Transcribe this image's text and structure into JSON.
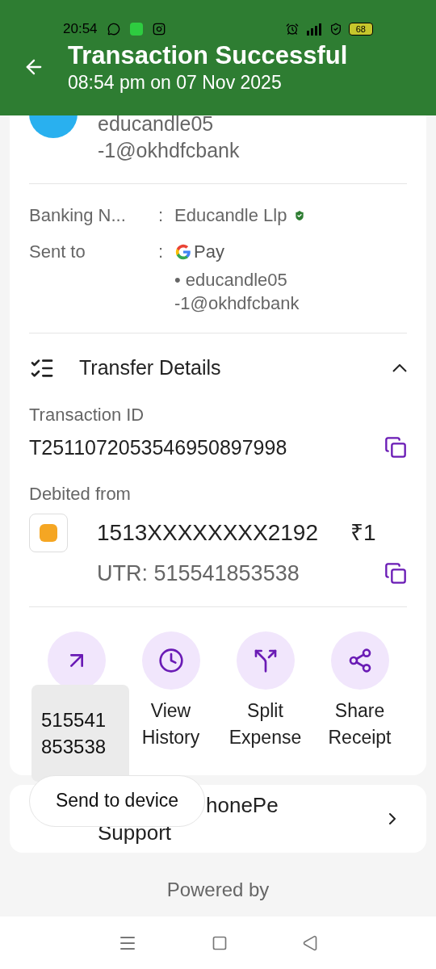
{
  "status_bar": {
    "time": "20:54",
    "battery": "68"
  },
  "header": {
    "title": "Transaction Successful",
    "subtitle": "08:54 pm on 07 Nov 2025"
  },
  "payee": {
    "upi_id": "educandle05\n-1@okhdfcbank"
  },
  "info_rows": [
    {
      "kind": "verified",
      "label": "Banking N...",
      "sep": ":",
      "value": "Educandle Llp"
    },
    {
      "kind": "gpay",
      "label": "Sent to",
      "sep": ":",
      "app": "Pay",
      "value": "• educandle05\n-1@okhdfcbank"
    }
  ],
  "transfer": {
    "title": "Transfer Details",
    "expanded": true,
    "id_label": "Transaction ID",
    "id": "T2511072053546950897998",
    "debited_label": "Debited from",
    "account_full": "1513XXXXXXXX2192",
    "amount": "₹1",
    "utr": "UTR: 515541853538"
  },
  "actions": [
    {
      "kind": "send"
    },
    {
      "kind": "history",
      "label": "View\nHistory"
    },
    {
      "kind": "split",
      "label": "Split\nExpense"
    },
    {
      "kind": "share",
      "label": "Share\nReceipt"
    }
  ],
  "copied_popup": "515541\n853538",
  "tooltip": "Send to device",
  "support": {
    "line1": "honePe",
    "line2": "Support"
  },
  "footer": "Powered by"
}
